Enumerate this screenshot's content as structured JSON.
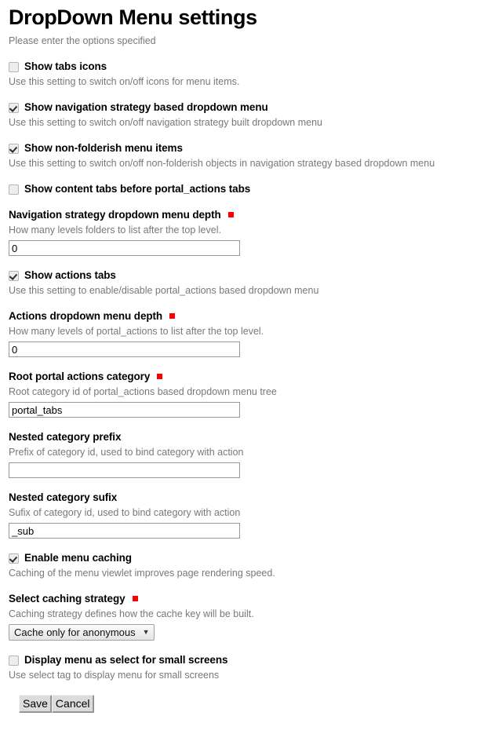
{
  "header": {
    "title": "DropDown Menu settings",
    "subtitle": "Please enter the options specified"
  },
  "fields": [
    {
      "type": "checkbox",
      "name": "show-tabs-icons",
      "label": "Show tabs icons",
      "checked": false,
      "description": "Use this setting to switch on/off icons for menu items."
    },
    {
      "type": "checkbox",
      "name": "show-navigation-strategy-dropdown",
      "label": "Show navigation strategy based dropdown menu",
      "checked": true,
      "description": "Use this setting to switch on/off navigation strategy built dropdown menu"
    },
    {
      "type": "checkbox",
      "name": "show-non-folderish-menu-items",
      "label": "Show non-folderish menu items",
      "checked": true,
      "description": "Use this setting to switch on/off non-folderish objects in navigation strategy based dropdown menu"
    },
    {
      "type": "checkbox",
      "name": "show-content-tabs-before-portal-actions",
      "label": "Show content tabs before portal_actions tabs",
      "checked": false,
      "description": ""
    },
    {
      "type": "text",
      "name": "navigation-strategy-dropdown-menu-depth",
      "label": "Navigation strategy dropdown menu depth",
      "required": true,
      "description": "How many levels folders to list after the top level.",
      "value": "0",
      "placeholder": ""
    },
    {
      "type": "checkbox",
      "name": "show-actions-tabs",
      "label": "Show actions tabs",
      "checked": true,
      "description": "Use this setting to enable/disable portal_actions based dropdown menu"
    },
    {
      "type": "text",
      "name": "actions-dropdown-menu-depth",
      "label": "Actions dropdown menu depth",
      "required": true,
      "description": "How many levels of portal_actions to list after the top level.",
      "value": "0",
      "placeholder": ""
    },
    {
      "type": "text",
      "name": "root-portal-actions-category",
      "label": "Root portal actions category",
      "required": true,
      "description": "Root category id of portal_actions based dropdown menu tree",
      "value": "portal_tabs",
      "placeholder": ""
    },
    {
      "type": "text",
      "name": "nested-category-prefix",
      "label": "Nested category prefix",
      "required": false,
      "description": "Prefix of category id, used to bind category with action",
      "value": "",
      "placeholder": ""
    },
    {
      "type": "text",
      "name": "nested-category-sufix",
      "label": "Nested category sufix",
      "required": false,
      "description": "Sufix of category id, used to bind category with action",
      "value": "_sub",
      "placeholder": ""
    },
    {
      "type": "checkbox",
      "name": "enable-menu-caching",
      "label": "Enable menu caching",
      "checked": true,
      "description": "Caching of the menu viewlet improves page rendering speed."
    },
    {
      "type": "select",
      "name": "select-caching-strategy",
      "label": "Select caching strategy",
      "required": true,
      "description": "Caching strategy defines how the cache key will be built.",
      "value": "Cache only for anonymous",
      "caret": "▼"
    },
    {
      "type": "checkbox",
      "name": "display-menu-as-select-small-screens",
      "label": "Display menu as select for small screens",
      "checked": false,
      "description": "Use select tag to display menu for small screens"
    }
  ],
  "buttons": {
    "save_label": "Save",
    "cancel_label": "Cancel"
  },
  "colors": {
    "required_marker": "#ff0000",
    "description_text": "#76797c",
    "input_border": "#999999"
  }
}
